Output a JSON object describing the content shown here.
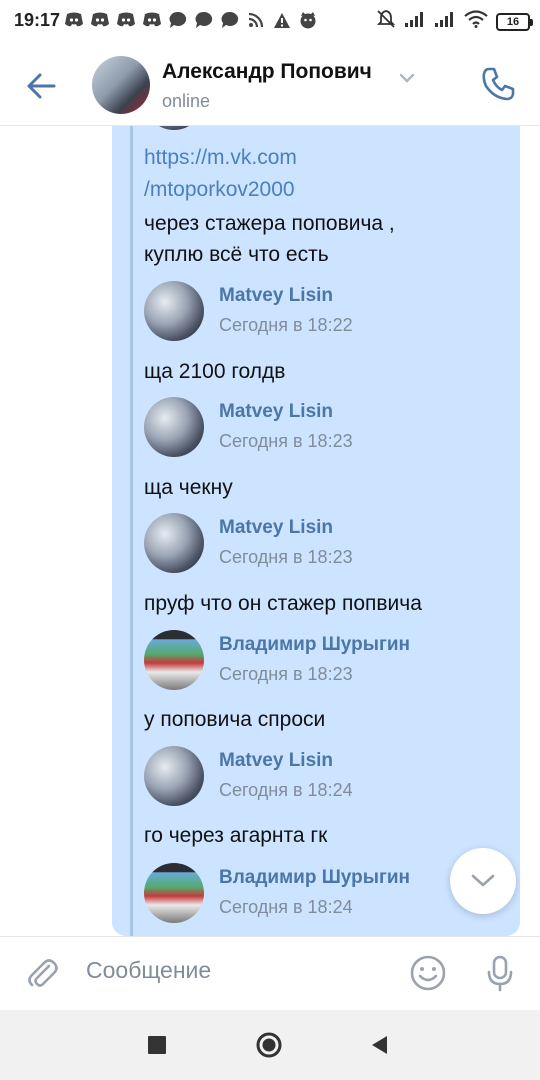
{
  "status_bar": {
    "time": "19:17",
    "battery": "16",
    "icons_left": [
      "discord-icon",
      "discord-icon",
      "discord-icon",
      "discord-icon",
      "chat-icon",
      "chat-icon",
      "chat-icon",
      "rss-icon",
      "warning-icon",
      "cat-icon"
    ],
    "icons_right": [
      "mute-icon",
      "signal-icon",
      "signal-icon",
      "wifi-icon",
      "battery-icon"
    ]
  },
  "header": {
    "name": "Александр Попович",
    "status": "online"
  },
  "messages": {
    "link1": "https://m.vk.com",
    "link2": "/mtoporkov2000",
    "text1a": "через стажера поповича ,",
    "text1b": "куплю всё что есть",
    "items": [
      {
        "name": "Matvey Lisin",
        "date": "Сегодня в 18:22",
        "text": "ща 2100 голдв"
      },
      {
        "name": "Matvey Lisin",
        "date": "Сегодня в 18:23",
        "text": "ща чекну"
      },
      {
        "name": "Matvey Lisin",
        "date": "Сегодня в 18:23",
        "text": "пруф что он стажер попвича"
      },
      {
        "name": "Владимир Шурыгин",
        "date": "Сегодня в 18:23",
        "text": "у поповича спроси"
      },
      {
        "name": "Matvey Lisin",
        "date": "Сегодня в 18:24",
        "text": "го через агарнта гк"
      },
      {
        "name": "Владимир Шурыгин",
        "date": "Сегодня в 18:24",
        "text": ""
      }
    ]
  },
  "composer": {
    "placeholder": "Сообщение"
  },
  "colors": {
    "accent": "#4a76a8",
    "bubble": "#cce4ff",
    "link": "#4a7fc1",
    "secondary_text": "#818c99"
  }
}
